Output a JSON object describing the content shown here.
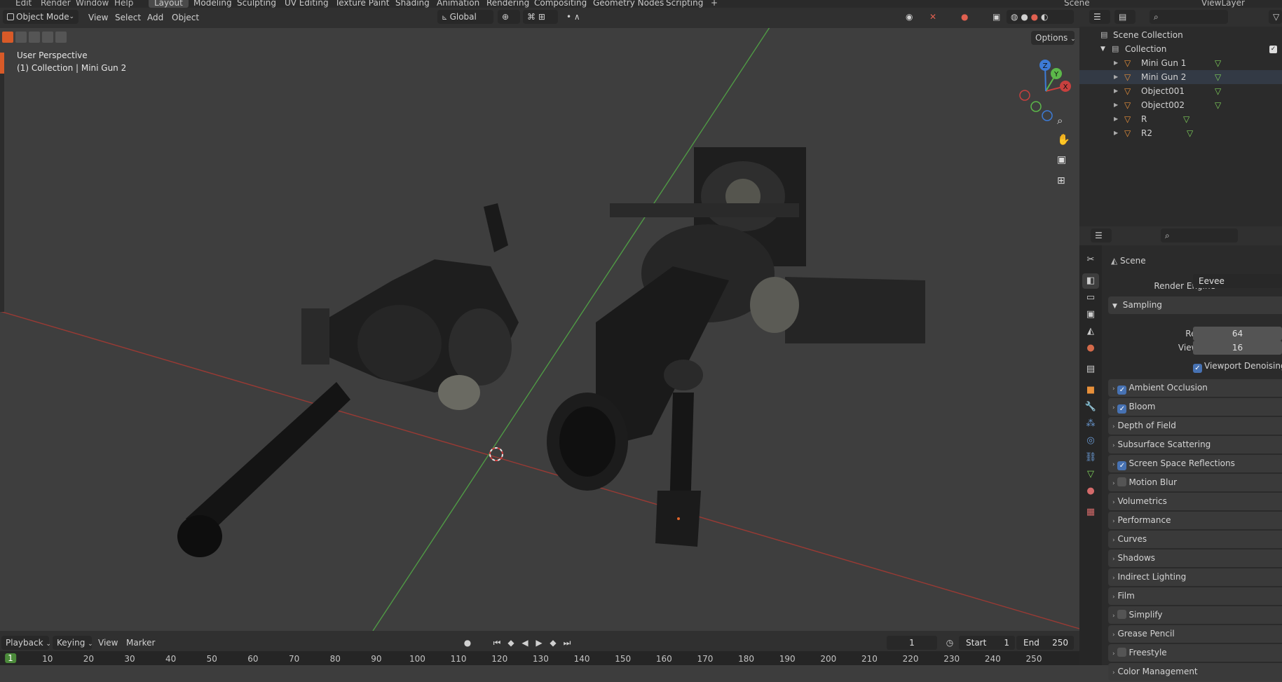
{
  "topbar": {
    "menus": [
      "Edit",
      "Render",
      "Window",
      "Help"
    ],
    "workspaces": [
      "Layout",
      "Modeling",
      "Sculpting",
      "UV Editing",
      "Texture Paint",
      "Shading",
      "Animation",
      "Rendering",
      "Compositing",
      "Geometry Nodes",
      "Scripting"
    ],
    "active_workspace": "Layout",
    "add_tab": "+",
    "scene": "Scene",
    "view_layer": "ViewLayer"
  },
  "viewport_header": {
    "mode": "Object Mode",
    "menus": [
      "View",
      "Select",
      "Add",
      "Object"
    ],
    "orientation": "Global",
    "options": "Options"
  },
  "viewport": {
    "perspective": "User Perspective",
    "context": "(1) Collection | Mini Gun 2",
    "gizmo_axes": [
      "X",
      "Y",
      "Z"
    ]
  },
  "timeline": {
    "menus": [
      "Playback",
      "Keying",
      "View",
      "Marker"
    ],
    "current_frame": "1",
    "start_label": "Start",
    "start": "1",
    "end_label": "End",
    "end": "250",
    "ruler_frames": [
      "1",
      "10",
      "20",
      "30",
      "40",
      "50",
      "60",
      "70",
      "80",
      "90",
      "100",
      "110",
      "120",
      "130",
      "140",
      "150",
      "160",
      "170",
      "180",
      "190",
      "200",
      "210",
      "220",
      "230",
      "240",
      "250"
    ]
  },
  "outliner": {
    "root": "Scene Collection",
    "collection": "Collection",
    "objects": [
      "Mini Gun 1",
      "Mini Gun 2",
      "Object001",
      "Object002",
      "R",
      "R2"
    ]
  },
  "properties": {
    "context": "Scene",
    "render_engine_label": "Render Engine",
    "render_engine": "Eevee",
    "sampling": {
      "title": "Sampling",
      "render_label": "Render",
      "render": "64",
      "viewport_label": "Viewport",
      "viewport": "16",
      "denoise_label": "Viewport Denoising"
    },
    "panels": [
      {
        "label": "Ambient Occlusion",
        "checkbox": true,
        "checked": true
      },
      {
        "label": "Bloom",
        "checkbox": true,
        "checked": true
      },
      {
        "label": "Depth of Field",
        "checkbox": false
      },
      {
        "label": "Subsurface Scattering",
        "checkbox": false
      },
      {
        "label": "Screen Space Reflections",
        "checkbox": true,
        "checked": true
      },
      {
        "label": "Motion Blur",
        "checkbox": true,
        "checked": false
      },
      {
        "label": "Volumetrics",
        "checkbox": false
      },
      {
        "label": "Performance",
        "checkbox": false
      },
      {
        "label": "Curves",
        "checkbox": false
      },
      {
        "label": "Shadows",
        "checkbox": false
      },
      {
        "label": "Indirect Lighting",
        "checkbox": false
      },
      {
        "label": "Film",
        "checkbox": false
      },
      {
        "label": "Simplify",
        "checkbox": true,
        "checked": false
      },
      {
        "label": "Grease Pencil",
        "checkbox": false
      },
      {
        "label": "Freestyle",
        "checkbox": true,
        "checked": false
      },
      {
        "label": "Color Management",
        "checkbox": false
      }
    ]
  },
  "colors": {
    "accent": "#4772b3",
    "object_icon": "#e8903a",
    "mesh_icon": "#7fd05a",
    "x_axis": "#c8403e",
    "y_axis": "#5cb84a",
    "z_axis": "#3d7bd6"
  }
}
